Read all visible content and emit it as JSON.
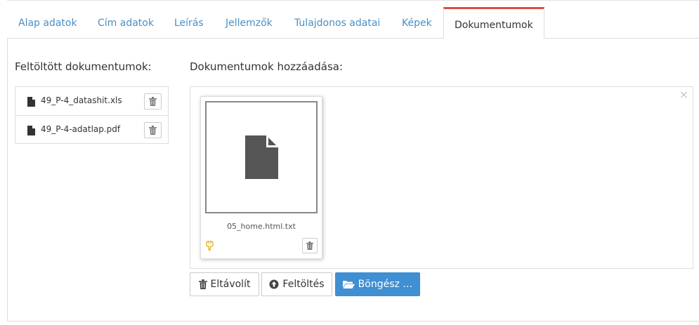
{
  "tabs": [
    {
      "label": "Alap adatok",
      "active": false
    },
    {
      "label": "Cím adatok",
      "active": false
    },
    {
      "label": "Leírás",
      "active": false
    },
    {
      "label": "Jellemzők",
      "active": false
    },
    {
      "label": "Tulajdonos adatai",
      "active": false
    },
    {
      "label": "Képek",
      "active": false
    },
    {
      "label": "Dokumentumok",
      "active": true
    }
  ],
  "uploaded": {
    "title": "Feltöltött dokumentumok:",
    "files": [
      {
        "name": "49_P-4_datashit.xls",
        "icon": "file-icon"
      },
      {
        "name": "49_P-4-adatlap.pdf",
        "icon": "file-icon"
      }
    ]
  },
  "add": {
    "title": "Dokumentumok hozzáadása:",
    "close_symbol": "×",
    "preview": {
      "file_name": "05_home.html.txt",
      "icon": "file-icon"
    }
  },
  "buttons": {
    "remove": "Eltávolít",
    "upload": "Feltöltés",
    "browse": "Böngész …"
  },
  "colors": {
    "tab_link": "#4a8fc3",
    "tab_active_border": "#e04a4a",
    "primary_button": "#3f8fd2",
    "drag_icon": "#e8b020"
  }
}
